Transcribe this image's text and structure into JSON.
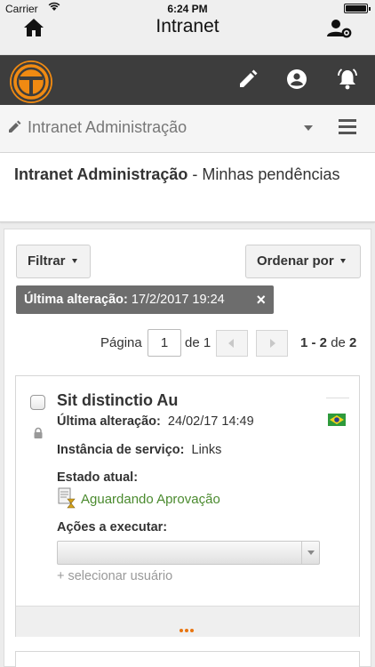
{
  "status_bar": {
    "carrier": "Carrier",
    "time": "6:24 PM"
  },
  "nav": {
    "title": "Intranet",
    "home_icon": "home-icon",
    "user_admin_icon": "user-settings-icon"
  },
  "toolbar": {
    "icons": [
      "logo",
      "pencil-icon",
      "account-icon",
      "alarm-bell-icon"
    ],
    "brand_color": "#f08a12",
    "bar_color": "#3d3d3d"
  },
  "breadcrumb": {
    "label": "Intranet Administração"
  },
  "header": {
    "title_bold": "Intranet Administração",
    "title_rest": " - Minhas pendências"
  },
  "filters": {
    "filter_label": "Filtrar",
    "sort_label": "Ordenar por"
  },
  "active_filter": {
    "label": "Última alteração:",
    "value": "17/2/2017 19:24",
    "remove": "×"
  },
  "pagination": {
    "page_label": "Página",
    "current_page": "1",
    "of_label": "de 1",
    "range": "1 - 2",
    "range_of": "de",
    "total": "2"
  },
  "items": [
    {
      "title": "Sit distinctio Au",
      "last_change_label": "Última alteração:",
      "last_change_value": "24/02/17 14:49",
      "service_label": "Instância de serviço:",
      "service_value": "Links",
      "state_label": "Estado atual:",
      "state_value": "Aguardando Aprovação",
      "actions_label": "Ações a executar:",
      "select_user": "+ selecionar usuário",
      "status_color": "#4a8a2e"
    }
  ]
}
